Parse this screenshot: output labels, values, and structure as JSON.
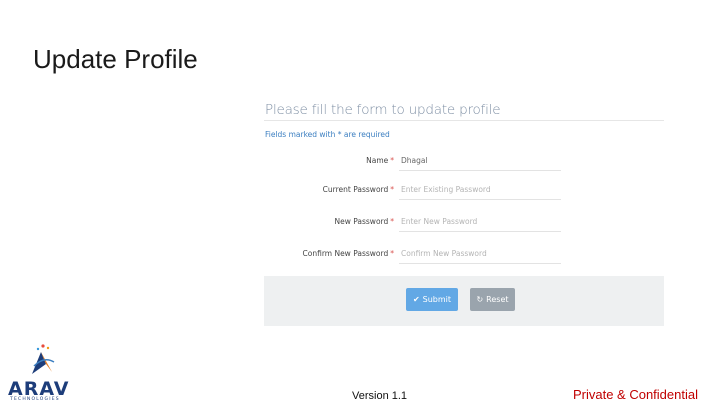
{
  "slide": {
    "title": "Update Profile"
  },
  "form": {
    "heading": "Please fill the form to update profile",
    "required_note": "Fields marked with * are required",
    "required_marker": "*",
    "fields": [
      {
        "label": "Name",
        "value": "Dhagal",
        "placeholder": ""
      },
      {
        "label": "Current Password",
        "value": "",
        "placeholder": "Enter Existing Password"
      },
      {
        "label": "New Password",
        "value": "",
        "placeholder": "Enter New Password"
      },
      {
        "label": "Confirm New Password",
        "value": "",
        "placeholder": "Confirm New Password"
      }
    ],
    "submit_label": "Submit",
    "reset_label": "Reset",
    "colors": {
      "submit": "#62a8e5",
      "reset": "#9aa4ad",
      "required": "#d9534f",
      "note": "#3c7fc1"
    }
  },
  "footer": {
    "logo_text": "ARAV",
    "logo_subtext": "TECHNOLOGIES",
    "version": "Version 1.1",
    "confidential": "Private & Confidential"
  }
}
